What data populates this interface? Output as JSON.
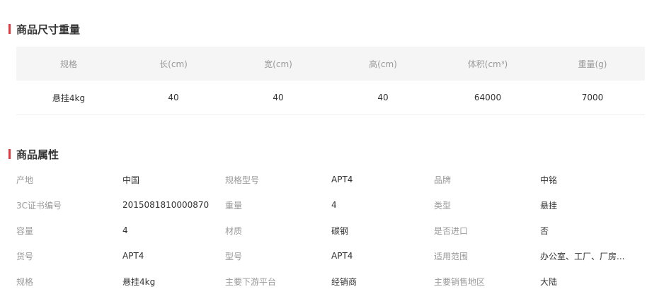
{
  "dimensions_section": {
    "title": "商品尺寸重量",
    "columns": [
      "规格",
      "长(cm)",
      "宽(cm)",
      "高(cm)",
      "体积(cm³)",
      "重量(g)"
    ],
    "rows": [
      [
        "悬挂4kg",
        "40",
        "40",
        "40",
        "64000",
        "7000"
      ]
    ]
  },
  "attributes_section": {
    "title": "商品属性",
    "rows": [
      [
        {
          "key": "产地",
          "value": "中国"
        },
        {
          "key": "规格型号",
          "value": "APT4"
        },
        {
          "key": "品牌",
          "value": "中铭"
        }
      ],
      [
        {
          "key": "3C证书编号",
          "value": "2015081810000870"
        },
        {
          "key": "重量",
          "value": "4"
        },
        {
          "key": "类型",
          "value": "悬挂"
        }
      ],
      [
        {
          "key": "容量",
          "value": "4"
        },
        {
          "key": "材质",
          "value": "碳钢"
        },
        {
          "key": "是否进口",
          "value": "否"
        }
      ],
      [
        {
          "key": "货号",
          "value": "APT4"
        },
        {
          "key": "型号",
          "value": "APT4"
        },
        {
          "key": "适用范围",
          "value": "办公室、工厂、厂房..."
        }
      ],
      [
        {
          "key": "规格",
          "value": "悬挂4kg"
        },
        {
          "key": "主要下游平台",
          "value": "经销商"
        },
        {
          "key": "主要销售地区",
          "value": "大陆"
        }
      ]
    ]
  },
  "colors": {
    "accent": "#e4393c",
    "header_bg": "#f5f5f5",
    "label_text": "#999999",
    "value_text": "#333333"
  }
}
